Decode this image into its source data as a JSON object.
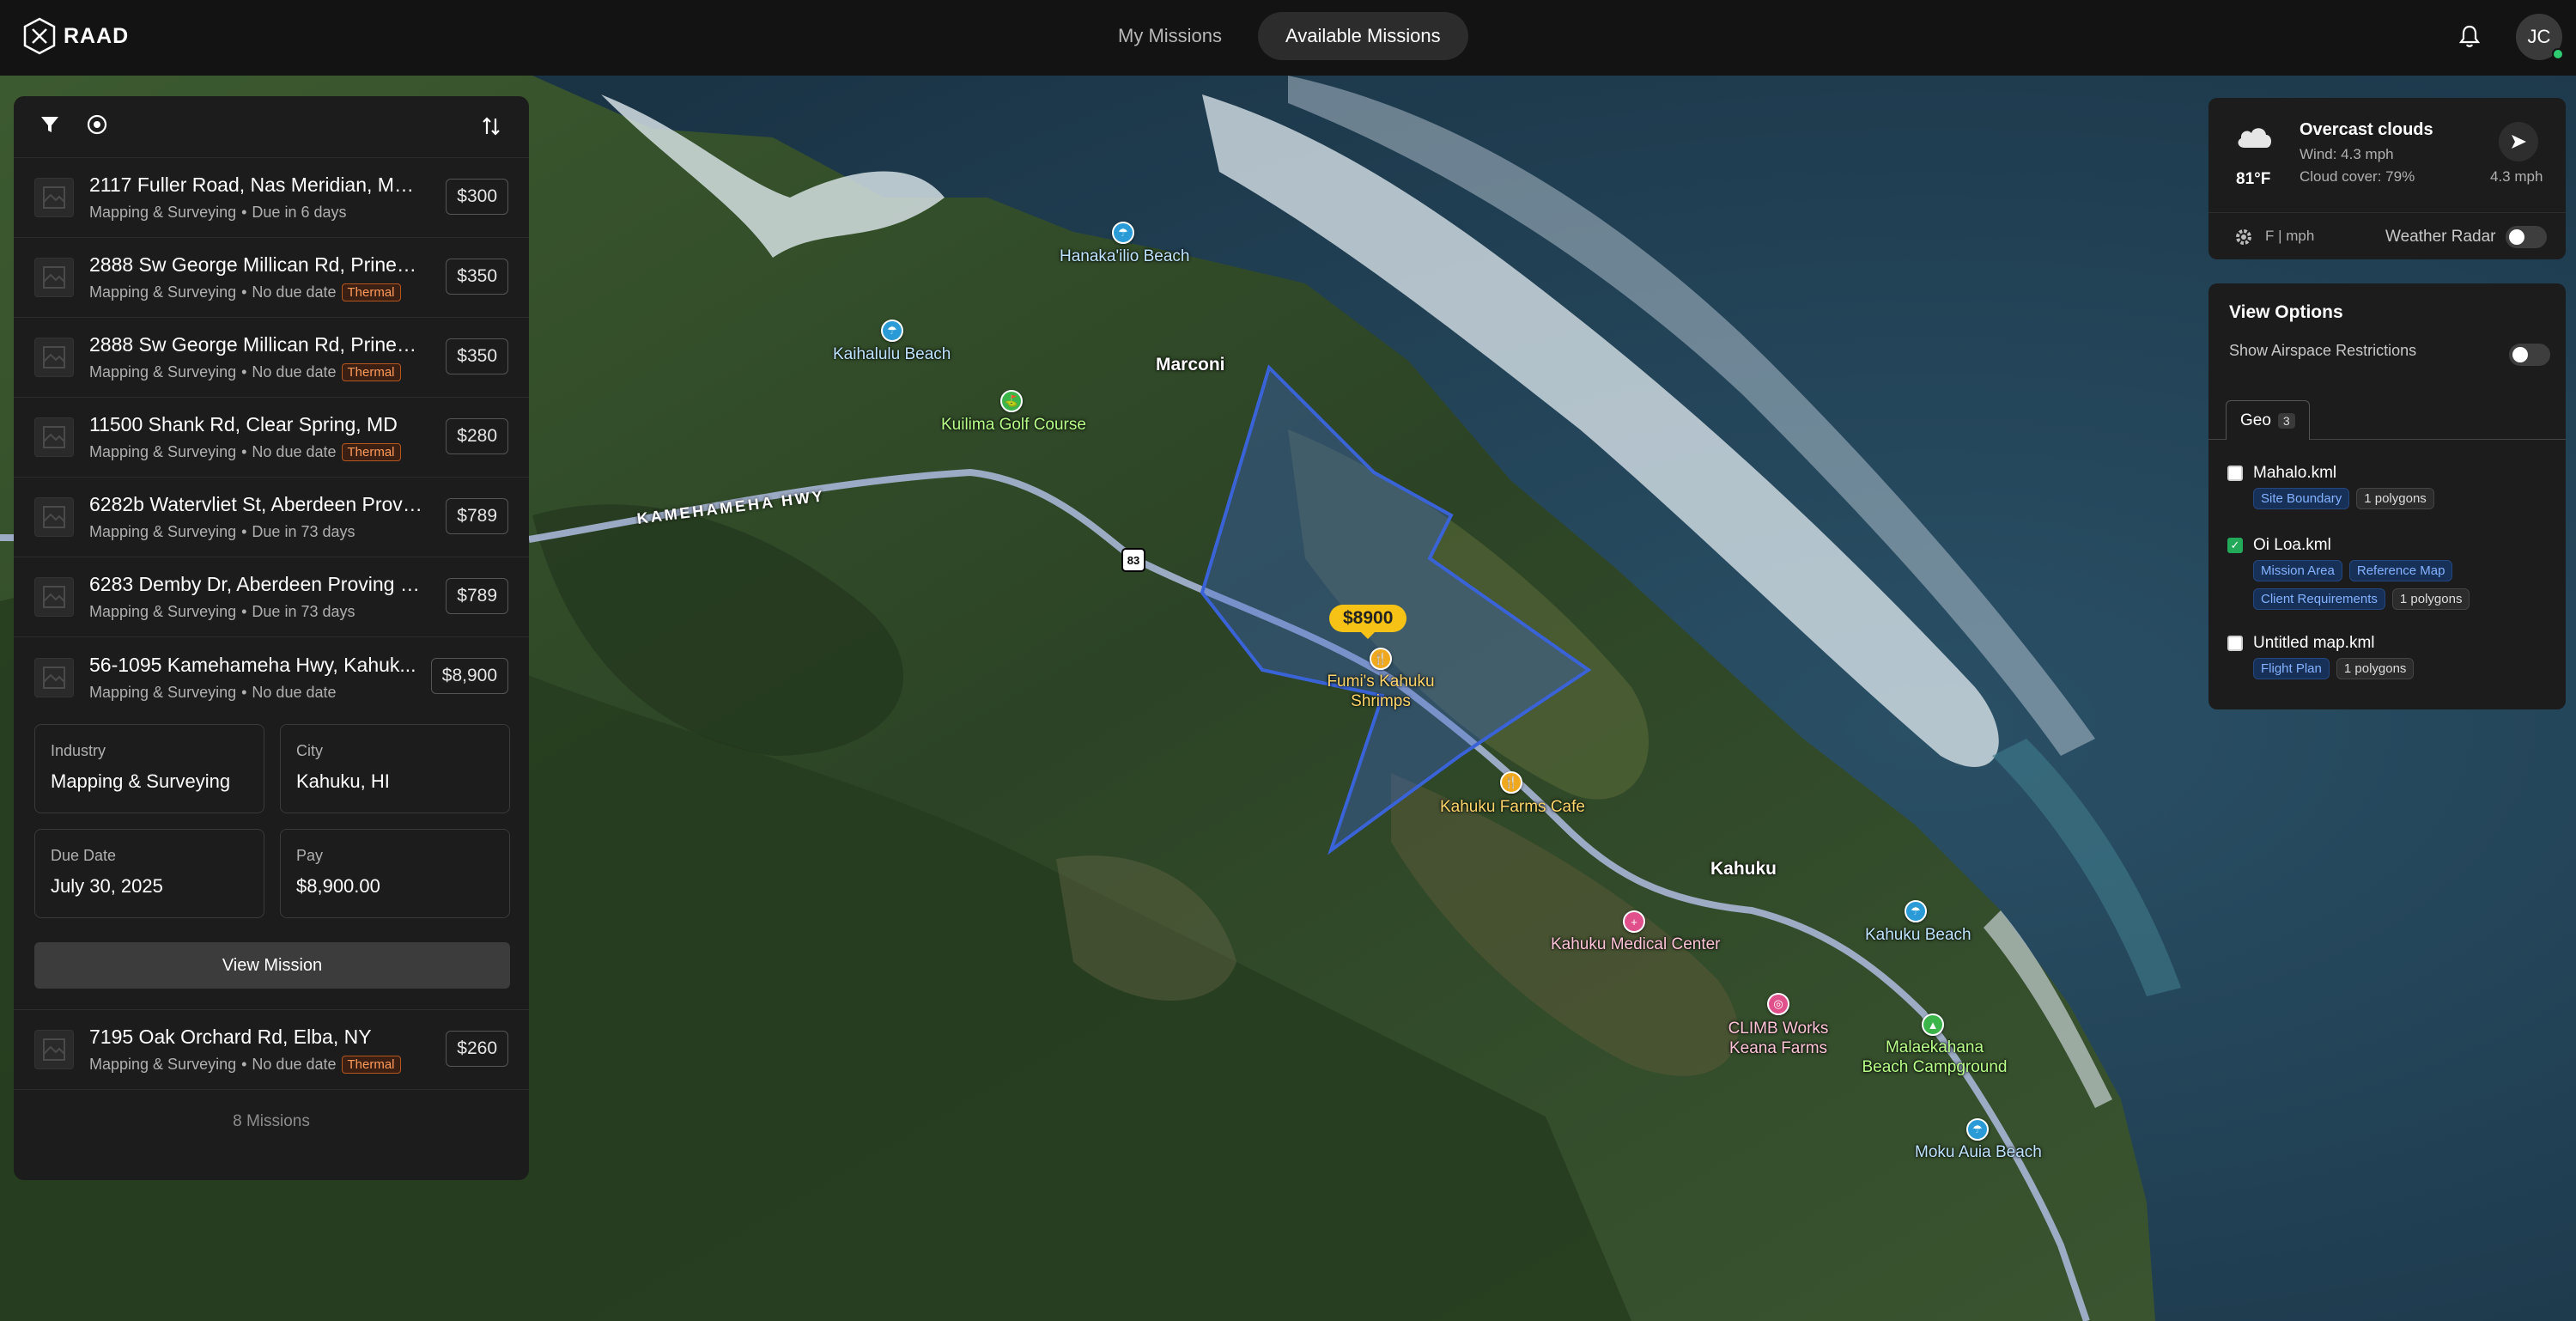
{
  "app": {
    "name": "RAAD"
  },
  "nav": {
    "tabs": [
      "My Missions",
      "Available Missions"
    ],
    "active": "Available Missions"
  },
  "user": {
    "initials": "JC"
  },
  "missions": [
    {
      "title": "2117 Fuller Road, Nas Meridian, Merid...",
      "industry": "Mapping & Surveying",
      "due": "Due in 6 days",
      "thermal": "",
      "price": "$300"
    },
    {
      "title": "2888 Sw George Millican Rd, Prinevill...",
      "industry": "Mapping & Surveying",
      "due": "No due date",
      "thermal": "Thermal",
      "price": "$350"
    },
    {
      "title": "2888 Sw George Millican Rd, Prinevill...",
      "industry": "Mapping & Surveying",
      "due": "No due date",
      "thermal": "Thermal",
      "price": "$350"
    },
    {
      "title": "11500 Shank Rd, Clear Spring, MD",
      "industry": "Mapping & Surveying",
      "due": "No due date",
      "thermal": "Thermal",
      "price": "$280"
    },
    {
      "title": "6282b Watervliet St, Aberdeen Provin...",
      "industry": "Mapping & Surveying",
      "due": "Due in 73 days",
      "thermal": "",
      "price": "$789"
    },
    {
      "title": "6283 Demby Dr, Aberdeen Proving Gr...",
      "industry": "Mapping & Surveying",
      "due": "Due in 73 days",
      "thermal": "",
      "price": "$789"
    },
    {
      "title": "56-1095 Kamehameha Hwy, Kahuk...",
      "industry": "Mapping & Surveying",
      "due": "No due date",
      "thermal": "",
      "price": "$8,900"
    },
    {
      "title": "7195 Oak Orchard Rd, Elba, NY",
      "industry": "Mapping & Surveying",
      "due": "No due date",
      "thermal": "Thermal",
      "price": "$260"
    }
  ],
  "separator": "•",
  "detail": {
    "industry_label": "Industry",
    "industry_value": "Mapping & Surveying",
    "city_label": "City",
    "city_value": "Kahuku, HI",
    "due_label": "Due Date",
    "due_value": "July 30, 2025",
    "pay_label": "Pay",
    "pay_value": "$8,900.00",
    "button": "View Mission"
  },
  "mission_count": "8 Missions",
  "weather": {
    "temp": "81°F",
    "condition": "Overcast clouds",
    "wind": "Wind: 4.3 mph",
    "cloud_cover": "Cloud cover: 79%",
    "wind_speed": "4.3 mph",
    "units": "F | mph",
    "radar_label": "Weather Radar",
    "radar_on": false
  },
  "view_options": {
    "title": "View Options",
    "airspace_label": "Show Airspace Restrictions",
    "airspace_on": false,
    "tab": "Geo",
    "tab_count": "3",
    "files": [
      {
        "name": "Mahalo.kml",
        "checked": false,
        "tags": [
          "Site Boundary"
        ],
        "count": "1 polygons"
      },
      {
        "name": "Oi Loa.kml",
        "checked": true,
        "tags": [
          "Mission Area",
          "Reference Map",
          "Client Requirements"
        ],
        "count": "1 polygons"
      },
      {
        "name": "Untitled map.kml",
        "checked": false,
        "tags": [
          "Flight Plan"
        ],
        "count": "1 polygons"
      }
    ]
  },
  "map": {
    "price_pin": "$8900",
    "highway_shield": "83",
    "road_label": "KAMEHAMEHA HWY",
    "labels": {
      "hanaka": "Hanaka'ilio Beach",
      "kaihalulu": "Kaihalulu Beach",
      "marconi": "Marconi",
      "kuilima": "Kuilima Golf Course",
      "fumis": "Fumi's Kahuku Shrimps",
      "farms_cafe": "Kahuku Farms Cafe",
      "kahuku": "Kahuku",
      "medical": "Kahuku Medical Center",
      "kahuku_beach": "Kahuku Beach",
      "climb": "CLIMB Works Keana Farms",
      "malaekahana": "Malaekahana Beach Campground",
      "moku": "Moku Auia Beach"
    },
    "colors": {
      "polygon": "#3a63d8",
      "road": "#a9b6d6",
      "ocean": "#1f3d52",
      "land": "#2f4a27"
    }
  }
}
